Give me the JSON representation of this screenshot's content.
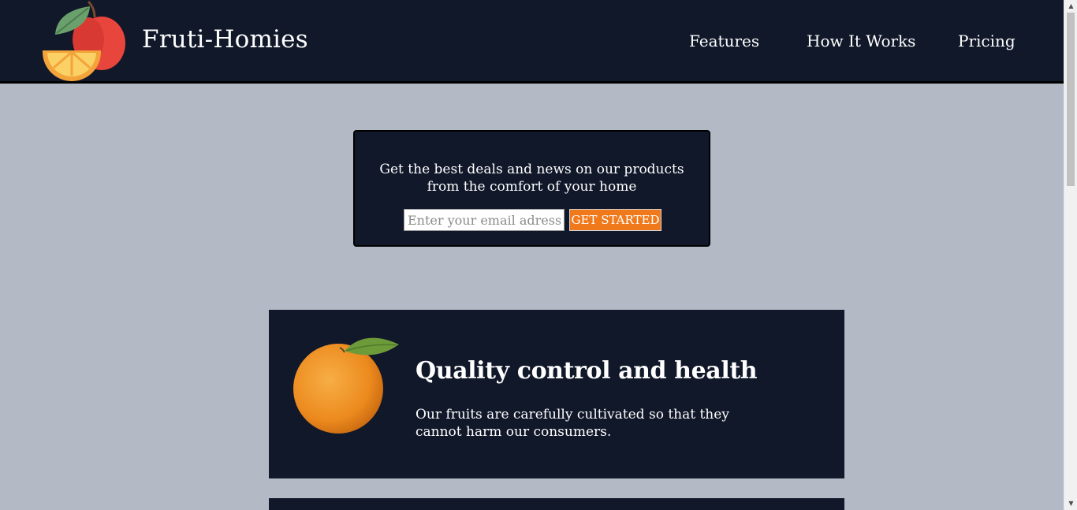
{
  "header": {
    "brand": "Fruti-Homies",
    "logo_icon": "fruit-logo-icon",
    "nav": [
      {
        "label": "Features"
      },
      {
        "label": "How It Works"
      },
      {
        "label": "Pricing"
      }
    ]
  },
  "signup": {
    "text": "Get the best deals and news on our products from the comfort of your home",
    "email_placeholder": "Enter your email adress",
    "button_label": "GET STARTED"
  },
  "feature": {
    "image_icon": "orange-icon",
    "title": "Quality control and health",
    "description": "Our fruits are carefully cultivated so that they cannot harm our consumers."
  },
  "colors": {
    "background": "#b3b9c5",
    "dark_panel": "#11182a",
    "accent": "#f07a1b"
  }
}
